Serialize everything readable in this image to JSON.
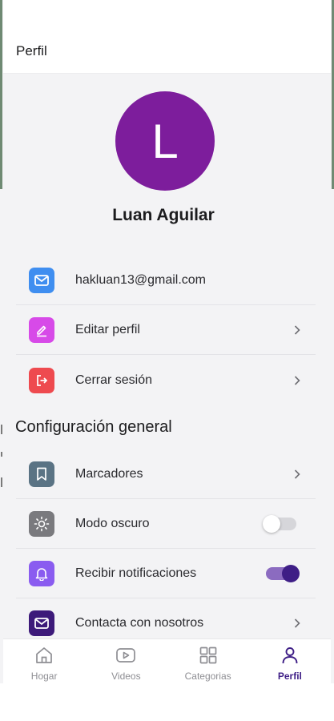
{
  "header": {
    "title": "Perfil"
  },
  "profile": {
    "initial": "L",
    "name": "Luan Aguilar",
    "avatar_color": "#7d1d9c"
  },
  "account": {
    "email": "hakluan13@gmail.com",
    "edit_label": "Editar perfil",
    "logout_label": "Cerrar sesión"
  },
  "settings": {
    "title": "Configuración general",
    "bookmarks_label": "Marcadores",
    "dark_mode_label": "Modo oscuro",
    "dark_mode_on": false,
    "notifications_label": "Recibir notificaciones",
    "notifications_on": true,
    "contact_label": "Contacta con nosotros"
  },
  "tabs": [
    {
      "label": "Hogar",
      "icon": "home-icon",
      "active": false
    },
    {
      "label": "Videos",
      "icon": "play-icon",
      "active": false
    },
    {
      "label": "Categorias",
      "icon": "grid-icon",
      "active": false
    },
    {
      "label": "Perfil",
      "icon": "user-icon",
      "active": true
    }
  ],
  "colors": {
    "email_icon_bg": "#3f8ef0",
    "edit_icon_bg": "#d74ae8",
    "logout_icon_bg": "#ee4a4f",
    "bookmarks_icon_bg": "#5a7384",
    "dark_mode_icon_bg": "#7a7a7e",
    "notifications_icon_bg": "#8a5cf0",
    "contact_icon_bg": "#3d1a7a",
    "accent": "#3e1e86"
  }
}
